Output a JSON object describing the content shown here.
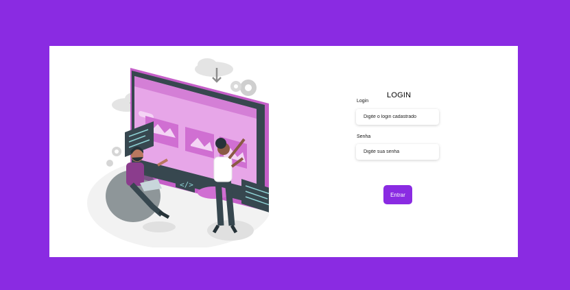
{
  "login": {
    "title": "LOGIN",
    "login_label": "Login",
    "login_placeholder": "Digite o login cadastrado",
    "password_label": "Senha",
    "password_placeholder": "Digite sua senha",
    "submit_label": "Entrar"
  },
  "colors": {
    "background": "#8a2be2",
    "card": "#ffffff",
    "accent": "#8a2be2"
  },
  "illustration": {
    "name": "web-development-illustration"
  }
}
